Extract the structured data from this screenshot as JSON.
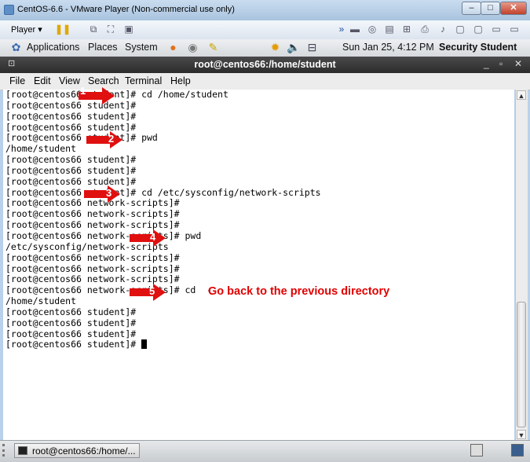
{
  "vm_window": {
    "title": "CentOS-6.6 - VMware Player (Non-commercial use only)",
    "minimize": "–",
    "maximize": "□",
    "close": "✕"
  },
  "vm_toolbar": {
    "player_label": "Player ▾",
    "icons": [
      "pause-icon",
      "removable-devices-icon",
      "fullscreen-icon",
      "unity-icon",
      "vm-devices-icon"
    ]
  },
  "gnome_panel": {
    "applications": "Applications",
    "places": "Places",
    "system": "System",
    "datetime": "Sun Jan 25,  4:12 PM",
    "user": "Security Student"
  },
  "terminal": {
    "title": "root@centos66:/home/student",
    "window_controls": {
      "minimize": "_",
      "maximize": "▫",
      "close": "✕"
    },
    "menu": [
      "File",
      "Edit",
      "View",
      "Search",
      "Terminal",
      "Help"
    ],
    "lines": [
      "[root@centos66 student]# cd /home/student",
      "[root@centos66 student]#",
      "[root@centos66 student]#",
      "[root@centos66 student]#",
      "[root@centos66 student]# pwd",
      "/home/student",
      "[root@centos66 student]#",
      "[root@centos66 student]#",
      "[root@centos66 student]#",
      "[root@centos66 student]# cd /etc/sysconfig/network-scripts",
      "[root@centos66 network-scripts]#",
      "[root@centos66 network-scripts]#",
      "[root@centos66 network-scripts]#",
      "[root@centos66 network-scripts]# pwd",
      "/etc/sysconfig/network-scripts",
      "[root@centos66 network-scripts]#",
      "[root@centos66 network-scripts]#",
      "[root@centos66 network-scripts]#",
      "[root@centos66 network-scripts]# cd  -",
      "/home/student",
      "[root@centos66 student]#",
      "[root@centos66 student]#",
      "[root@centos66 student]#",
      "[root@centos66 student]# "
    ]
  },
  "annotations": {
    "arrow_color": "#e01010",
    "markers": [
      "1",
      "2",
      "3",
      "4",
      "5"
    ],
    "note": "Go back to the previous directory"
  },
  "bottom_panel": {
    "task": "root@centos66:/home/..."
  }
}
